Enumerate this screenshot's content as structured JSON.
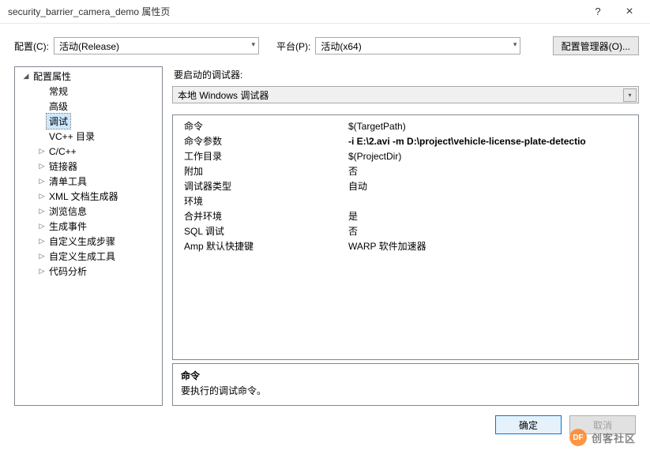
{
  "titlebar": {
    "title": "security_barrier_camera_demo 属性页",
    "help": "?",
    "close": "×"
  },
  "toolbar": {
    "config_label": "配置(C):",
    "config_value": "活动(Release)",
    "platform_label": "平台(P):",
    "platform_value": "活动(x64)",
    "cfgmgr": "配置管理器(O)..."
  },
  "tree": {
    "root": "配置属性",
    "items": [
      {
        "label": "常规",
        "tw": ""
      },
      {
        "label": "高级",
        "tw": ""
      },
      {
        "label": "调试",
        "tw": "",
        "selected": true
      },
      {
        "label": "VC++ 目录",
        "tw": ""
      },
      {
        "label": "C/C++",
        "tw": "▷"
      },
      {
        "label": "链接器",
        "tw": "▷"
      },
      {
        "label": "清单工具",
        "tw": "▷"
      },
      {
        "label": "XML 文档生成器",
        "tw": "▷"
      },
      {
        "label": "浏览信息",
        "tw": "▷"
      },
      {
        "label": "生成事件",
        "tw": "▷"
      },
      {
        "label": "自定义生成步骤",
        "tw": "▷"
      },
      {
        "label": "自定义生成工具",
        "tw": "▷"
      },
      {
        "label": "代码分析",
        "tw": "▷"
      }
    ]
  },
  "right": {
    "debugger_label": "要启动的调试器:",
    "debugger_value": "本地 Windows 调试器",
    "grid": [
      {
        "label": "命令",
        "value": "$(TargetPath)"
      },
      {
        "label": "命令参数",
        "value": "-i E:\\2.avi -m D:\\project\\vehicle-license-plate-detectio",
        "bold": true
      },
      {
        "label": "工作目录",
        "value": "$(ProjectDir)"
      },
      {
        "label": "附加",
        "value": "否"
      },
      {
        "label": "调试器类型",
        "value": "自动"
      },
      {
        "label": "环境",
        "value": ""
      },
      {
        "label": "合并环境",
        "value": "是"
      },
      {
        "label": "SQL 调试",
        "value": "否"
      },
      {
        "label": "Amp 默认快捷键",
        "value": "WARP 软件加速器"
      }
    ],
    "desc": {
      "title": "命令",
      "body": "要执行的调试命令。"
    }
  },
  "footer": {
    "ok": "确定",
    "cancel": "取消"
  },
  "watermark": {
    "badge": "DF",
    "text": "创客社区"
  }
}
